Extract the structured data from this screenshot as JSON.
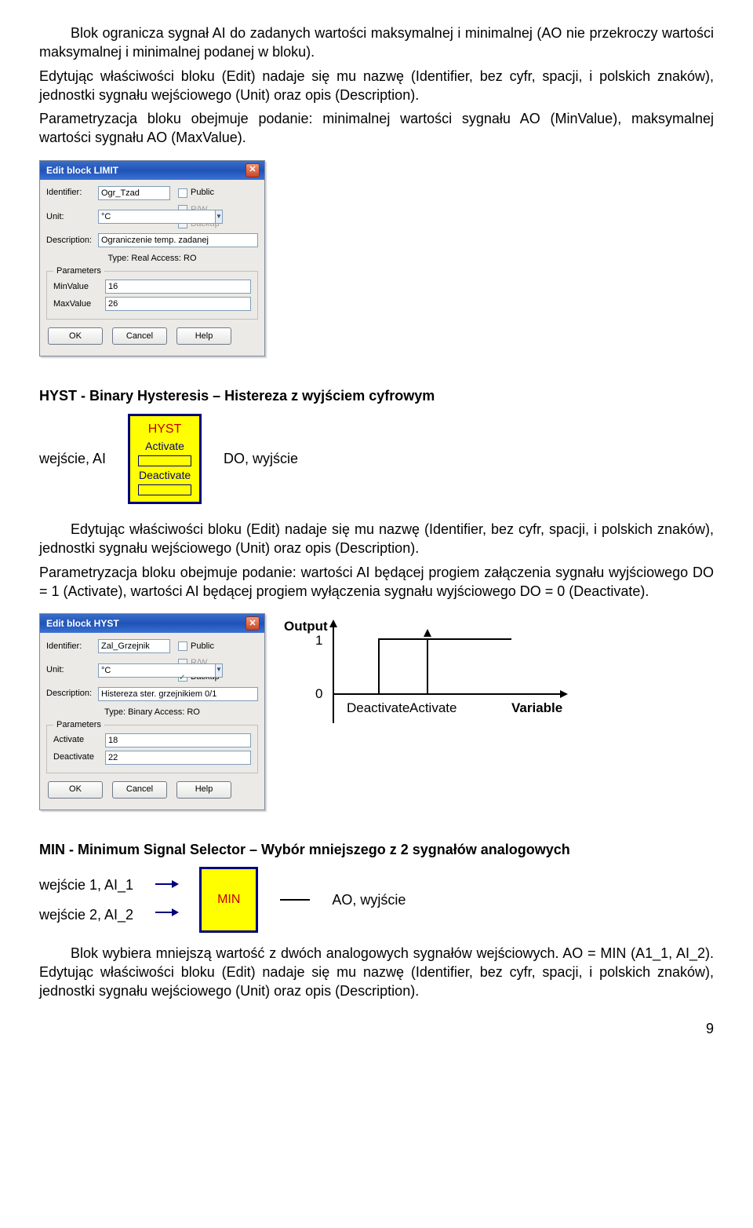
{
  "paragraphs": {
    "p1": "Blok ogranicza sygnał AI do zadanych wartości maksymalnej i minimalnej (AO nie przekroczy wartości maksymalnej i minimalnej podanej w bloku).",
    "p2a": "Edytując właściwości bloku (Edit) nadaje się mu nazwę (Identifier, bez cyfr, spacji, i polskich znaków), jednostki sygnału wejściowego (Unit) oraz opis (Description).",
    "p2b": "Parametryzacja bloku obejmuje podanie: minimalnej wartości sygnału AO (MinValue), maksymalnej wartości sygnału AO (MaxValue).",
    "p3a": "Edytując właściwości bloku (Edit) nadaje się mu nazwę (Identifier, bez cyfr, spacji, i polskich znaków), jednostki sygnału wejściowego (Unit) oraz opis (Description).",
    "p3b": "Parametryzacja bloku obejmuje podanie: wartości AI będącej progiem załączenia sygnału wyjściowego DO = 1 (Activate), wartości AI będącej progiem wyłączenia sygnału wyjściowego DO = 0 (Deactivate).",
    "p4": "Blok wybiera mniejszą wartość z dwóch analogowych sygnałów wejściowych. AO = MIN (A1_1, AI_2). Edytując właściwości bloku (Edit) nadaje się mu nazwę (Identifier, bez cyfr, spacji, i polskich znaków), jednostki sygnału wejściowego (Unit) oraz opis (Description)."
  },
  "sections": {
    "hyst_title": "HYST - Binary Hysteresis – Histereza z wyjściem cyfrowym",
    "min_title": "MIN - Minimum Signal Selector – Wybór mniejszego z 2 sygnałów analogowych"
  },
  "common": {
    "labels": {
      "identifier": "Identifier:",
      "unit": "Unit:",
      "description": "Description:",
      "parameters_legend": "Parameters"
    },
    "checks": {
      "public": "Public",
      "rw": "R/W",
      "backup": "Backup"
    },
    "buttons": {
      "ok": "OK",
      "cancel": "Cancel",
      "help": "Help"
    },
    "type_real": "Type: Real   Access: RO",
    "type_binary": "Type: Binary   Access: RO"
  },
  "dialog_limit": {
    "title": "Edit block LIMIT",
    "identifier": "Ogr_Tzad",
    "unit": "°C",
    "description": "Ograniczenie temp. zadanej",
    "params": {
      "min_label": "MinValue",
      "min": "16",
      "max_label": "MaxValue",
      "max": "26"
    }
  },
  "dialog_hyst": {
    "title": "Edit block HYST",
    "identifier": "Zal_Grzejnik",
    "unit": "°C",
    "description": "Histereza ster. grzejnikiem 0/1",
    "params": {
      "act_label": "Activate",
      "act": "18",
      "deact_label": "Deactivate",
      "deact": "22"
    }
  },
  "hyst_block": {
    "title": "HYST",
    "activate": "Activate",
    "deactivate": "Deactivate",
    "left_lbl": "wejście, AI",
    "right_lbl": "DO, wyjście"
  },
  "waveform": {
    "title": "Output",
    "one": "1",
    "zero": "0",
    "deactivate": "Deactivate",
    "activate": "Activate",
    "variable": "Variable"
  },
  "min_block": {
    "title": "MIN",
    "in1": "wejście 1, AI_1",
    "in2": "wejście 2, AI_2",
    "out": "AO, wyjście"
  },
  "page_number": "9"
}
